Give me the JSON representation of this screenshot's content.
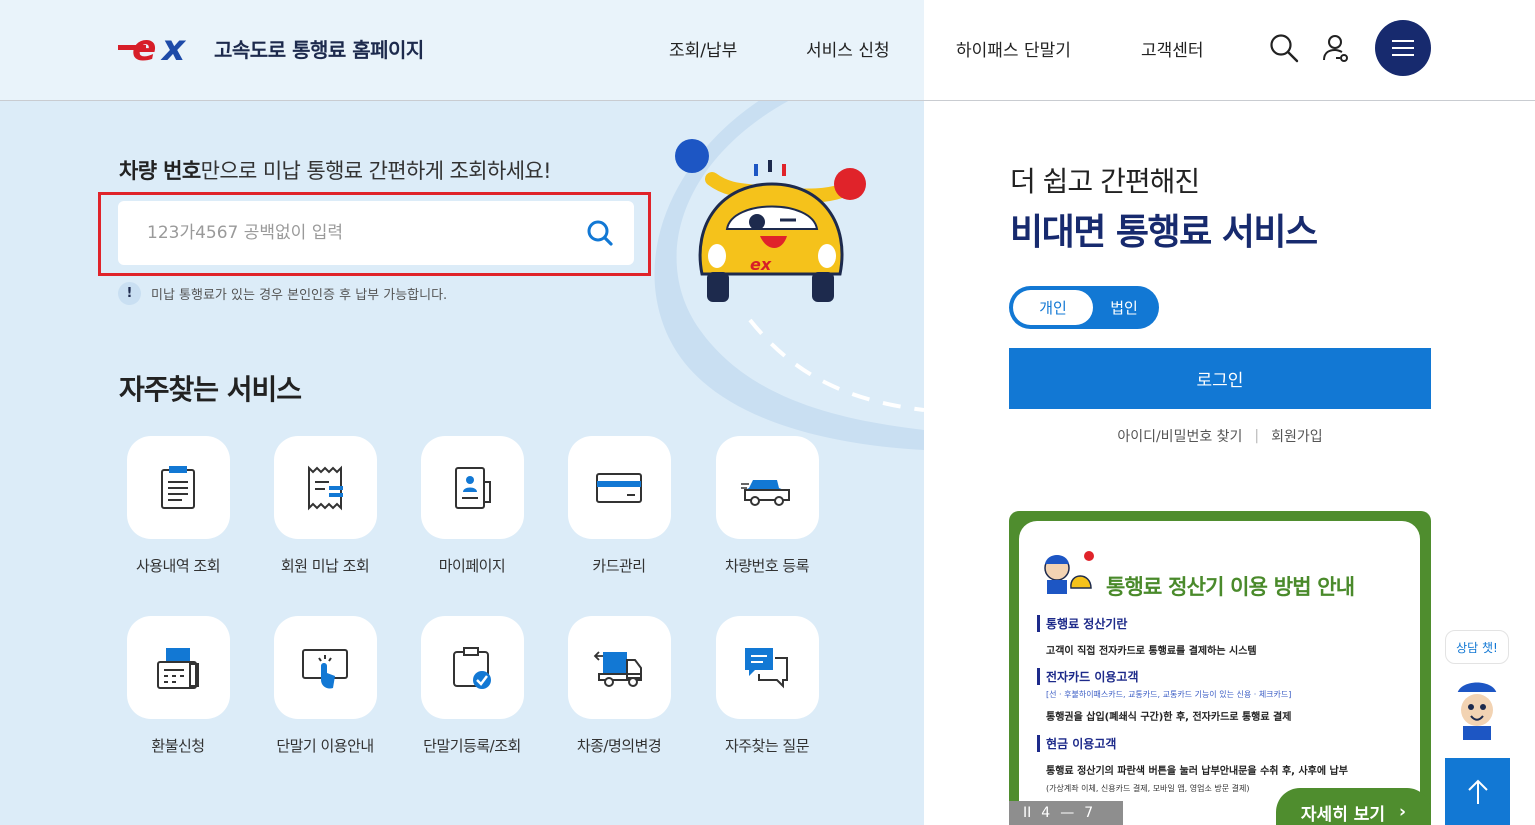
{
  "header": {
    "site_title": "고속도로 통행료 홈페이지",
    "nav": [
      "조회/납부",
      "서비스 신청",
      "하이패스 단말기",
      "고객센터"
    ],
    "icons": [
      "search-icon",
      "user-icon",
      "menu-icon"
    ]
  },
  "search": {
    "headline_bold": "차량 번호",
    "headline_rest": "만으로 미납 통행료 간편하게 조회하세요!",
    "placeholder": "123가4567 공백없이 입력",
    "notice_icon": "!",
    "notice": "미납 통행료가 있는 경우 본인인증 후 납부 가능합니다."
  },
  "faq": {
    "title": "자주찾는 서비스",
    "items": [
      {
        "label": "사용내역 조회",
        "icon": "document-list-icon"
      },
      {
        "label": "회원 미납 조회",
        "icon": "receipt-icon"
      },
      {
        "label": "마이페이지",
        "icon": "profile-card-icon"
      },
      {
        "label": "카드관리",
        "icon": "credit-card-icon"
      },
      {
        "label": "차량번호 등록",
        "icon": "car-icon"
      },
      {
        "label": "환불신청",
        "icon": "fax-machine-icon"
      },
      {
        "label": "단말기 이용안내",
        "icon": "touch-screen-icon"
      },
      {
        "label": "단말기등록/조회",
        "icon": "clipboard-check-icon"
      },
      {
        "label": "차종/명의변경",
        "icon": "truck-change-icon"
      },
      {
        "label": "자주찾는 질문",
        "icon": "chat-bubbles-icon"
      }
    ]
  },
  "login": {
    "subtitle": "더 쉽고 간편해진",
    "title": "비대면 통행료 서비스",
    "toggle_personal": "개인",
    "toggle_corporate": "법인",
    "login_button": "로그인",
    "find_id_pw": "아이디/비밀번호 찾기",
    "signup": "회원가입"
  },
  "banner": {
    "title": "통행료 정산기 이용 방법 안내",
    "sections": [
      {
        "head": "통행료 정산기란",
        "desc": "고객이 직접 전자카드로 통행료를 결제하는 시스템",
        "note": "",
        "note2": ""
      },
      {
        "head": "전자카드 이용고객",
        "desc": "통행권을 삽입(폐쇄식 구간)한 후, 전자카드로 통행료 결제",
        "note": "[선 · 후불하이패스카드, 교통카드, 교통카드 기능이 있는 신용 · 체크카드]",
        "note2": ""
      },
      {
        "head": "현금 이용고객",
        "desc": "통행료 정산기의 파란색 버튼을 눌러 납부안내문을 수취 후, 사후에 납부",
        "note": "",
        "note2": "(가상계좌 이체, 신용카드 결제, 모바일 앱, 영업소 방문 결제)"
      }
    ],
    "pager_pause": "II",
    "pager_current": "4",
    "pager_sep": "—",
    "pager_total": "7",
    "more_label": "자세히 보기",
    "more_arrow": "›"
  },
  "chatbot": {
    "label": "상담 챗!"
  },
  "colors": {
    "brand_navy": "#172a6e",
    "primary_blue": "#1278d4",
    "highlight_red": "#e0232a",
    "banner_green": "#4f8d2e",
    "left_panel_bg": "#dcecf8"
  }
}
